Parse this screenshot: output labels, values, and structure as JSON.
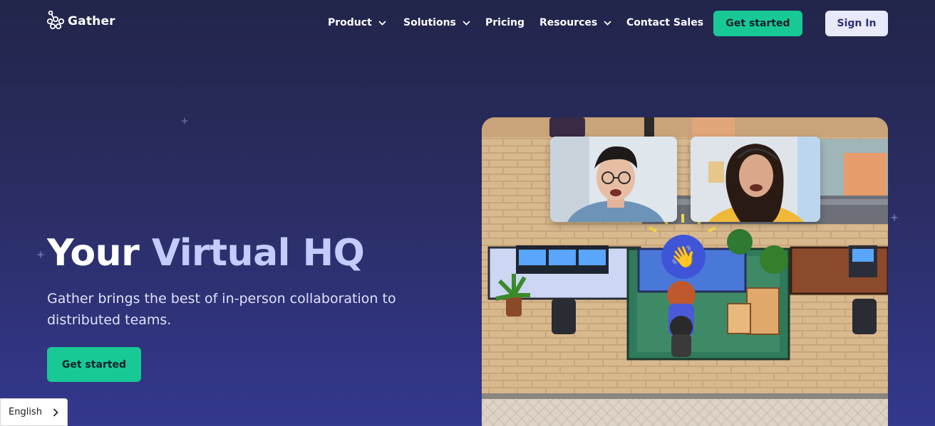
{
  "brand": {
    "name": "Gather"
  },
  "nav": {
    "items": [
      {
        "label": "Product",
        "has_dropdown": true
      },
      {
        "label": "Solutions",
        "has_dropdown": true
      },
      {
        "label": "Pricing",
        "has_dropdown": false
      },
      {
        "label": "Resources",
        "has_dropdown": true
      },
      {
        "label": "Contact Sales",
        "has_dropdown": false
      }
    ],
    "get_started_label": "Get started",
    "sign_in_label": "Sign In"
  },
  "hero": {
    "headline_part1": "Your",
    "headline_part2": "Virtual HQ",
    "subtitle": "Gather brings the best of in-person collaboration to distributed teams.",
    "cta_label": "Get started",
    "wave_emoji": "👋"
  },
  "language": {
    "current": "English"
  },
  "colors": {
    "accent_green": "#18c996",
    "signin_bg": "#e8e9fb",
    "headline_highlight": "#c4ccff",
    "background_top": "#22254a",
    "background_bottom": "#34388e"
  },
  "icons": {
    "logo": "gather-logo-icon",
    "dropdown": "chevron-down-icon",
    "language": "chevron-right-icon",
    "wave": "waving-hand-icon"
  }
}
